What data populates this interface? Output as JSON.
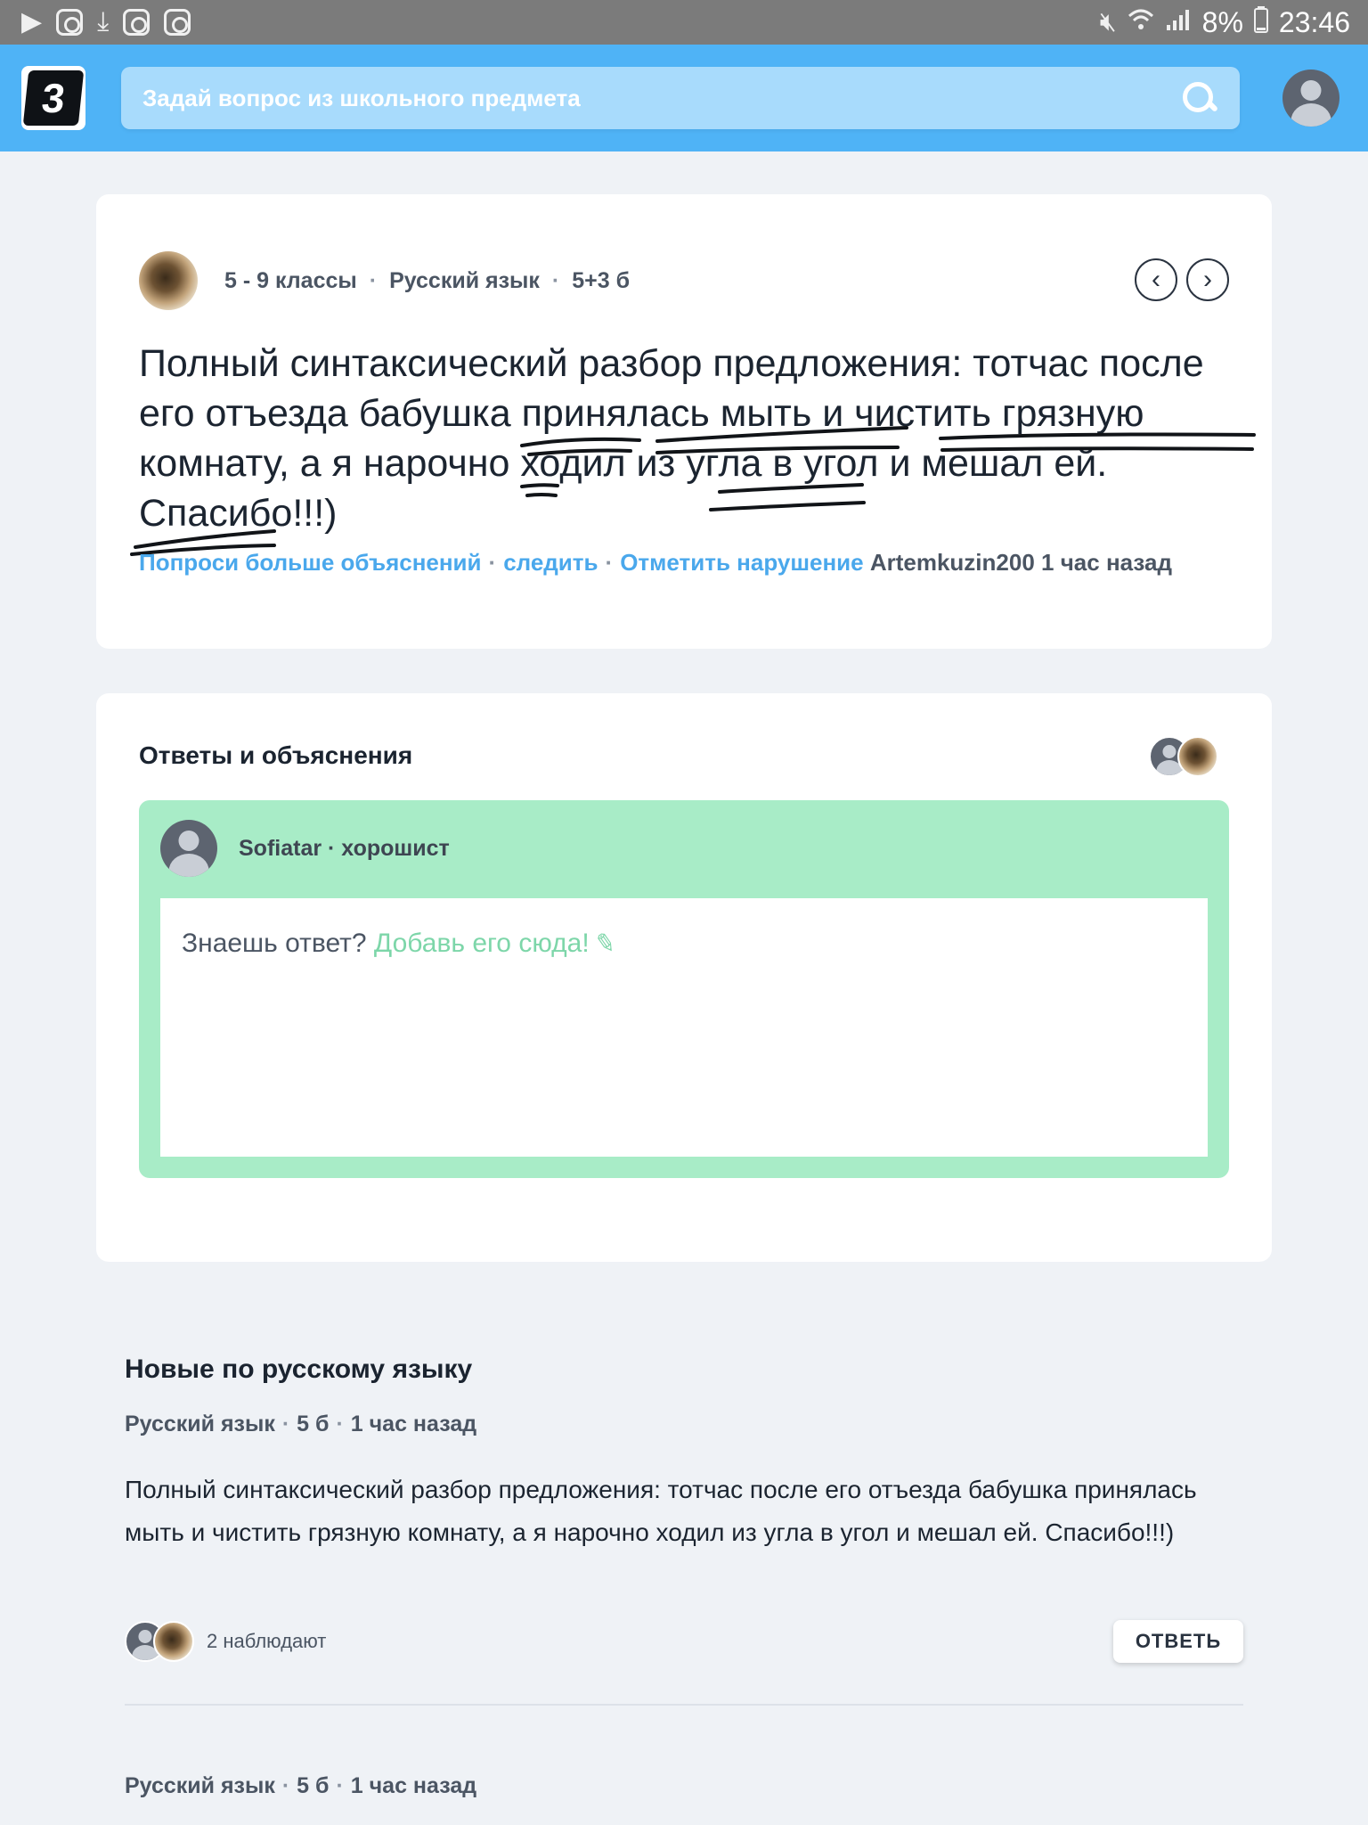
{
  "status_bar": {
    "battery": "8%",
    "time": "23:46",
    "icons": [
      "play-icon",
      "instagram-icon",
      "download-icon",
      "instagram-icon",
      "instagram-icon",
      "mute-icon",
      "wifi-icon",
      "signal-icon",
      "battery-icon"
    ]
  },
  "header": {
    "logo_text": "3",
    "search_placeholder": "Задай вопрос из школьного предмета"
  },
  "question": {
    "grade": "5 - 9 классы",
    "subject": "Русский язык",
    "points": "5+3 б",
    "text": "Полный синтаксический разбор предложения: тотчас после его отъезда бабушка принялась мыть и чистить грязную комнату, а я нарочно ходил из угла в угол и мешал ей. Спасибо!!!)",
    "links": {
      "ask_more": "Попроси больше объяснений",
      "follow": "следить",
      "report": "Отметить нарушение"
    },
    "author": "Artemkuzin200",
    "time": "1 час назад"
  },
  "answers": {
    "title": "Ответы и объяснения",
    "answerer": "Sofiatar · хорошист",
    "prompt": "Знаешь ответ?",
    "add_link": "Добавь его сюда!"
  },
  "new_questions": {
    "title": "Новые по русскому языку",
    "items": [
      {
        "subject": "Русский язык",
        "points": "5 б",
        "time": "1 час назад",
        "text": "Полный синтаксический разбор предложения: тотчас после его отъезда бабушка принялась мыть и чистить грязную комнату, а я нарочно ходил из угла в угол и мешал ей. Спасибо!!!)",
        "watchers": "2 наблюдают",
        "reply_label": "ОТВЕТЬ"
      },
      {
        "subject": "Русский язык",
        "points": "5 б",
        "time": "1 час назад"
      }
    ]
  },
  "colors": {
    "brand_blue": "#4fb3f6",
    "link_blue": "#4aa8ec",
    "answer_green": "#a8ecc7",
    "add_link_green": "#7dd6a9",
    "background": "#eff2f6"
  }
}
